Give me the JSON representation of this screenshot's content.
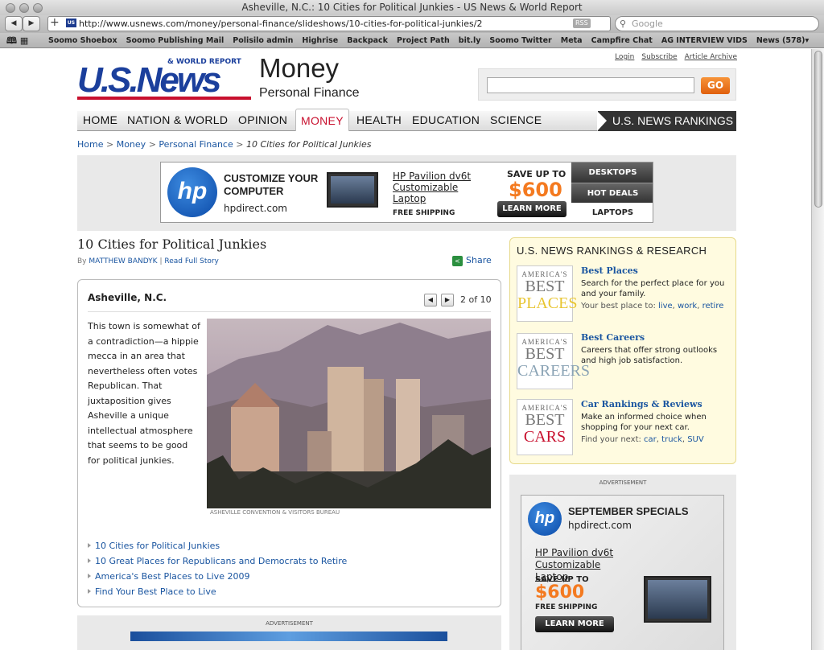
{
  "window": {
    "title": "Asheville, N.C.: 10 Cities for Political Junkies - US News & World Report"
  },
  "browser": {
    "url": "http://www.usnews.com/money/personal-finance/slideshows/10-cities-for-political-junkies/2",
    "rss": "RSS",
    "search_placeholder": "Google",
    "bookmarks": [
      "Soomo Shoebox",
      "Soomo Publishing Mail",
      "Polisilo admin",
      "Highrise",
      "Backpack",
      "Project Path",
      "bit.ly",
      "Soomo Twitter",
      "Meta",
      "Campfire Chat",
      "AG INTERVIEW VIDS",
      "News (578)▾"
    ]
  },
  "header": {
    "logo": "U.S.News",
    "logo_small": "& WORLD REPORT",
    "section": "Money",
    "subsection": "Personal Finance",
    "toplinks": [
      "Login",
      "Subscribe",
      "Article Archive"
    ],
    "go": "GO"
  },
  "nav": {
    "items": [
      "HOME",
      "NATION & WORLD",
      "OPINION",
      "MONEY",
      "HEALTH",
      "EDUCATION",
      "SCIENCE"
    ],
    "active": "MONEY",
    "rankings": "U.S. NEWS RANKINGS"
  },
  "breadcrumb": {
    "home": "Home",
    "money": "Money",
    "pf": "Personal Finance",
    "sep": ">",
    "current": "10 Cities for Political Junkies"
  },
  "top_ad": {
    "logo": "hp",
    "customize": "CUSTOMIZE YOUR COMPUTER",
    "url": "hpdirect.com",
    "product": "HP Pavilion dv6t Customizable Laptop",
    "shipping": "FREE SHIPPING",
    "save": "SAVE UP TO",
    "price": "$600",
    "learn": "LEARN MORE",
    "side": [
      "DESKTOPS",
      "HOT DEALS",
      "LAPTOPS"
    ]
  },
  "article": {
    "title": "10 Cities for Political Junkies",
    "by": "By",
    "author": "MATTHEW BANDYK",
    "sep": "|",
    "read_full": "Read Full Story",
    "share": "Share"
  },
  "slide": {
    "location": "Asheville, N.C.",
    "counter": "2 of 10",
    "description": "This town is somewhat of a contradiction—a hippie mecca in an area that nevertheless often votes Republican. That juxtaposition gives Asheville a unique intellectual atmosphere that seems to be good for political junkies.",
    "caption": "ASHEVILLE CONVENTION & VISITORS BUREAU",
    "links": [
      "10 Cities for Political Junkies",
      "10 Great Places for Republicans and Democrats to Retire",
      "America's Best Places to Live 2009",
      "Find Your Best Place to Live"
    ]
  },
  "rankings": {
    "title": "U.S. NEWS RANKINGS & RESEARCH",
    "badge_top": "AMERICA'S",
    "badge_mid": "BEST",
    "sections": [
      {
        "badge": "PLACES",
        "heading": "Best Places",
        "text": "Search for the perfect place for you and your family.",
        "footer_label": "Your best place to:",
        "links": [
          "live",
          "work",
          "retire"
        ]
      },
      {
        "badge": "CAREERS",
        "heading": "Best Careers",
        "text": "Careers that offer strong outlooks and high job satisfaction."
      },
      {
        "badge": "CARS",
        "heading": "Car Rankings & Reviews",
        "text": "Make an informed choice when shopping for your next car.",
        "footer_label": "Find your next:",
        "links": [
          "car",
          "truck",
          "SUV"
        ]
      }
    ],
    "badge_colors": {
      "places": "#e8c531",
      "careers": "#8aa3b5",
      "cars": "#c8102e"
    }
  },
  "side_ad": {
    "label": "ADVERTISEMENT",
    "logo": "hp",
    "headline": "SEPTEMBER SPECIALS",
    "url": "hpdirect.com",
    "product": "HP Pavilion dv6t Customizable Laptop",
    "save": "SAVE UP TO",
    "price": "$600",
    "shipping": "FREE SHIPPING",
    "learn": "LEARN MORE"
  },
  "bottom_ad": {
    "label": "ADVERTISEMENT"
  }
}
